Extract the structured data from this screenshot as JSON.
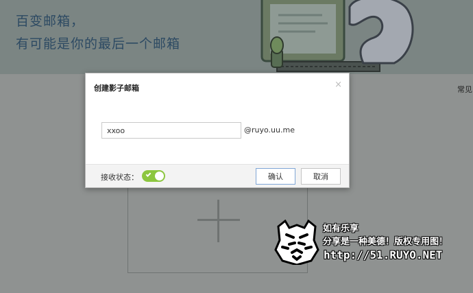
{
  "banner": {
    "line1": "百变邮箱，",
    "line2": "有可能是你的最后一个邮箱"
  },
  "side_link": "常见问题",
  "dialog": {
    "title": "创建影子邮箱",
    "close_symbol": "×",
    "input_value": "xxoo",
    "domain_suffix": "@ruyo.uu.me",
    "receive_label": "接收状态：",
    "receive_enabled": true,
    "ok_label": "确认",
    "cancel_label": "取消"
  },
  "watermark": {
    "line1": "如有乐享",
    "line2": "分享是一种美德！版权专用图！",
    "url": "http://51.RUYO.NET"
  },
  "colors": {
    "toggle_on": "#8cc63f",
    "tagline": "#2d4a63",
    "overlay_bg": "#8f9291"
  }
}
